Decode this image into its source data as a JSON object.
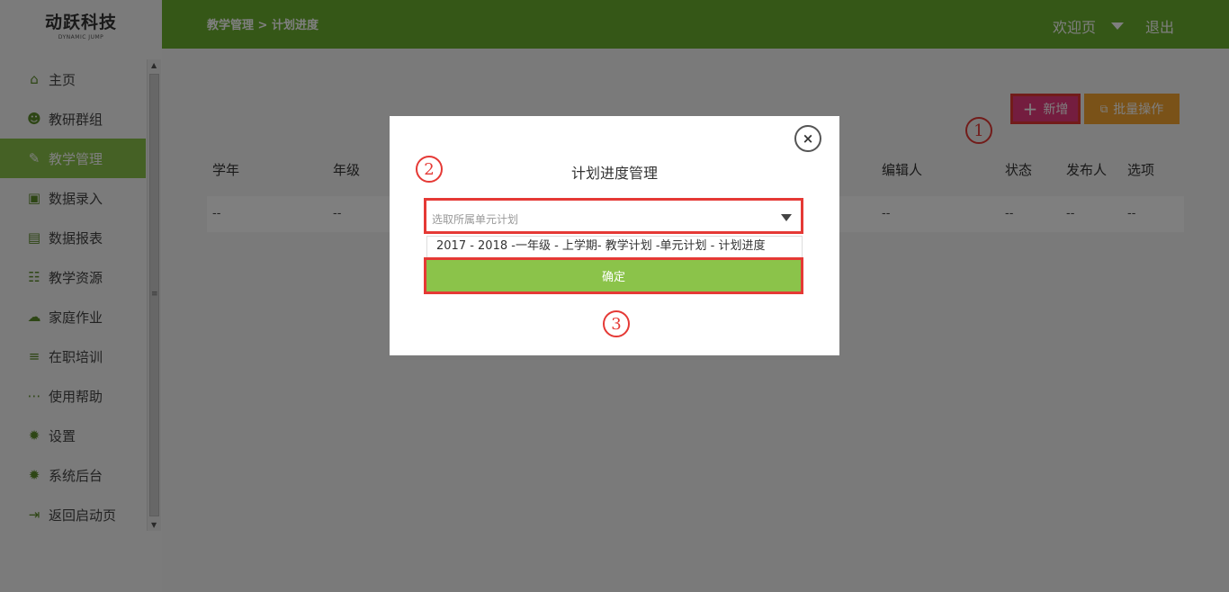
{
  "logo": {
    "main": "动跃科技",
    "sub": "DYNAMIC JUMP"
  },
  "sidebar": {
    "items": [
      {
        "label": "主页",
        "icon": "home-icon"
      },
      {
        "label": "教研群组",
        "icon": "users-icon"
      },
      {
        "label": "教学管理",
        "icon": "edit-icon",
        "active": true
      },
      {
        "label": "数据录入",
        "icon": "monitor-icon"
      },
      {
        "label": "数据报表",
        "icon": "report-icon"
      },
      {
        "label": "教学资源",
        "icon": "resource-icon"
      },
      {
        "label": "家庭作业",
        "icon": "homework-icon"
      },
      {
        "label": "在职培训",
        "icon": "training-icon"
      },
      {
        "label": "使用帮助",
        "icon": "help-icon"
      },
      {
        "label": "设置",
        "icon": "gear-icon"
      },
      {
        "label": "系统后台",
        "icon": "gear-icon"
      },
      {
        "label": "返回启动页",
        "icon": "exit-icon"
      }
    ]
  },
  "header": {
    "breadcrumb": "教学管理 > 计划进度",
    "welcome": "欢迎页",
    "logout": "退出"
  },
  "toolbar": {
    "add_label": "新增",
    "batch_label": "批量操作"
  },
  "table": {
    "columns": [
      "学年",
      "年级",
      "编辑人",
      "状态",
      "发布人",
      "选项"
    ],
    "row": [
      "--",
      "--",
      "--",
      "--",
      "--",
      "--"
    ]
  },
  "annotations": {
    "one": "1",
    "two": "2",
    "three": "3"
  },
  "modal": {
    "title": "计划进度管理",
    "close": "×",
    "select_placeholder": "选取所属单元计划",
    "option": "2017 - 2018 -一年级 - 上学期- 教学计划 -单元计划 - 计划进度",
    "confirm": "确定"
  },
  "colors": {
    "header": "#6aaf2e",
    "accent": "#8bc34a",
    "add": "#e93a7e",
    "batch": "#f4a530",
    "annotation": "#e53935"
  }
}
